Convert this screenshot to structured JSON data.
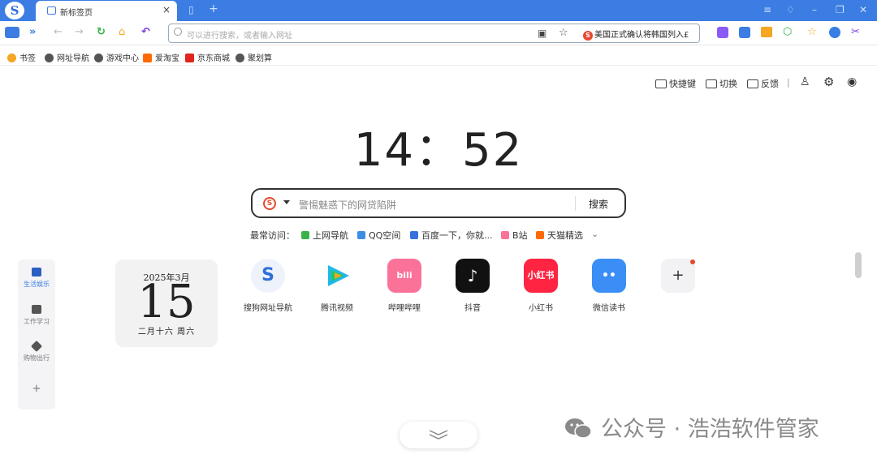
{
  "browser": {
    "tab_title": "新标签页",
    "tab_close": "×",
    "new_tab": "+",
    "address_placeholder": "可以进行搜索，或者输入网址",
    "news_ticker": "美国正式确认将韩国列入£"
  },
  "bookmarks": [
    {
      "label": "书签",
      "color": "#f5a623"
    },
    {
      "label": "网址导航",
      "color": "#555555"
    },
    {
      "label": "游戏中心",
      "color": "#555555"
    },
    {
      "label": "爱淘宝",
      "color": "#ff6a00"
    },
    {
      "label": "京东商城",
      "color": "#e1251b"
    },
    {
      "label": "聚划算",
      "color": "#555555"
    }
  ],
  "toolbar": {
    "shortcut": "快捷键",
    "switch": "切换",
    "feedback": "反馈"
  },
  "clock": "14：52",
  "search": {
    "placeholder": "警惕魅惑下的网贷陷阱",
    "button": "搜索"
  },
  "frequent": {
    "label": "最常访问：",
    "items": [
      {
        "label": "上网导航",
        "color": "#3cb34a"
      },
      {
        "label": "QQ空间",
        "color": "#3b8de3"
      },
      {
        "label": "百度一下，你就...",
        "color": "#3a6fe0"
      },
      {
        "label": "B站",
        "color": "#fb7299"
      },
      {
        "label": "天猫精选",
        "color": "#ff6a00"
      }
    ]
  },
  "sidebar": [
    {
      "label": "生活娱乐",
      "active": true
    },
    {
      "label": "工作学习",
      "active": false
    },
    {
      "label": "购物出行",
      "active": false
    },
    {
      "label": "+",
      "active": false
    }
  ],
  "calendar": {
    "year_month": "2025年3月",
    "day": "15",
    "lunar": "二月十六  周六"
  },
  "apps": [
    {
      "label": "搜狗网址导航",
      "color": "#eef3fb",
      "glyph": "S"
    },
    {
      "label": "腾讯视频",
      "color": "#ffffff",
      "glyph": "▶"
    },
    {
      "label": "哔哩哔哩",
      "color": "#fb7299",
      "glyph": "bili"
    },
    {
      "label": "抖音",
      "color": "#111111",
      "glyph": "♪"
    },
    {
      "label": "小红书",
      "color": "#ff2442",
      "glyph": "小红书"
    },
    {
      "label": "微信读书",
      "color": "#3a8ef6",
      "glyph": "••"
    }
  ],
  "add_tile": "+",
  "watermark": "公众号 · 浩浩软件管家"
}
